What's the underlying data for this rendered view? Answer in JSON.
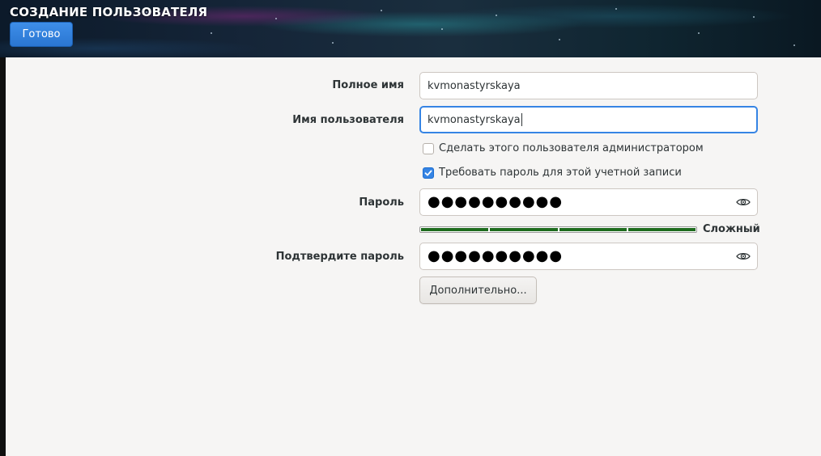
{
  "header": {
    "title": "СОЗДАНИЕ ПОЛЬЗОВАТЕЛЯ",
    "done_label": "Готово"
  },
  "form": {
    "full_name": {
      "label": "Полное имя",
      "value": "kvmonastyrskaya"
    },
    "username": {
      "label": "Имя пользователя",
      "value": "kvmonastyrskaya"
    },
    "admin_checkbox": {
      "label": "Сделать этого пользователя администратором",
      "checked": false
    },
    "require_password_checkbox": {
      "label": "Требовать пароль для этой учетной записи",
      "checked": true
    },
    "password": {
      "label": "Пароль",
      "masked_value": "●●●●●●●●●●"
    },
    "password_strength": {
      "level": 4,
      "max": 4,
      "label": "Сложный",
      "color": "#1e6b1e"
    },
    "confirm_password": {
      "label": "Подтвердите пароль",
      "masked_value": "●●●●●●●●●●"
    },
    "advanced_label": "Дополнительно..."
  },
  "icons": {
    "reveal": "eye-icon",
    "check": "checkmark-icon"
  },
  "colors": {
    "accent": "#3584e4",
    "done_button": "#2a76d2",
    "background": "#f6f5f4"
  }
}
